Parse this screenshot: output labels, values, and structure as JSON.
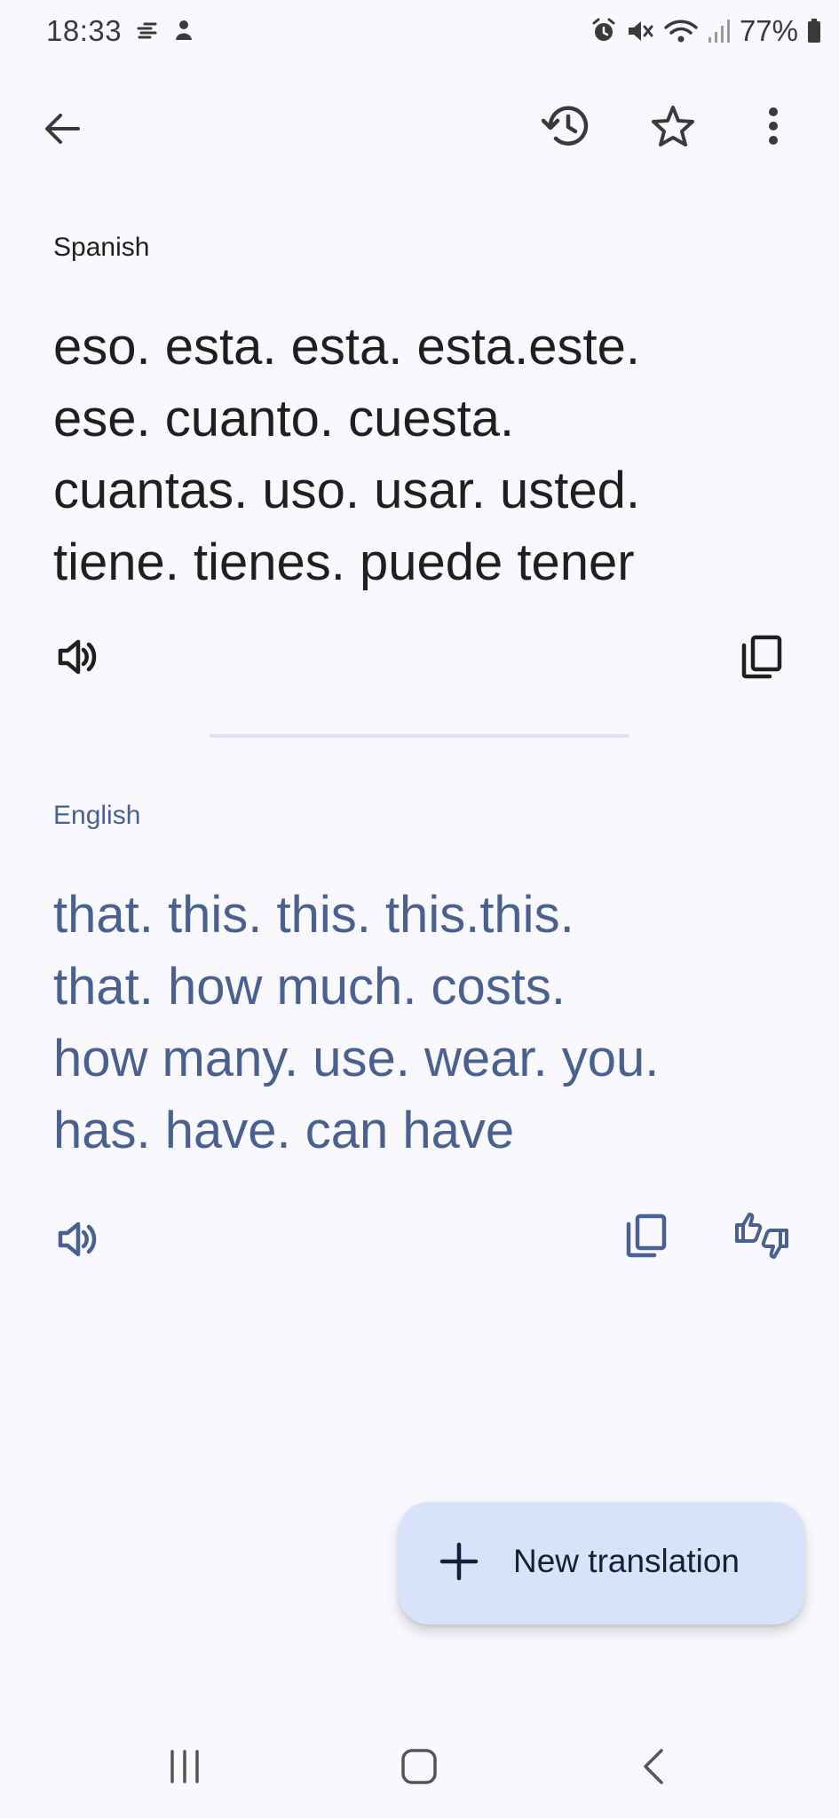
{
  "status_bar": {
    "time": "18:33",
    "battery": "77%"
  },
  "top_bar": {
    "back": "back-arrow-icon",
    "history": "history-icon",
    "favorite": "star-icon",
    "more": "more-vert-icon"
  },
  "source": {
    "language": "Spanish",
    "lines": [
      "eso. esta. esta. esta.este.",
      "ese. cuanto. cuesta.",
      "cuantas. uso. usar. usted.",
      "tiene. tienes. puede tener"
    ]
  },
  "target": {
    "language": "English",
    "lines": [
      "that.  this.  this.  this.this.",
      "that.  how much.  costs.",
      "how many.  use.  wear.  you.",
      "has.  have.  can have"
    ]
  },
  "fab": {
    "label": "New translation"
  },
  "colors": {
    "background": "#f8f8fd",
    "translation_text": "#4a6190",
    "fab_background": "#d8e2fb"
  }
}
